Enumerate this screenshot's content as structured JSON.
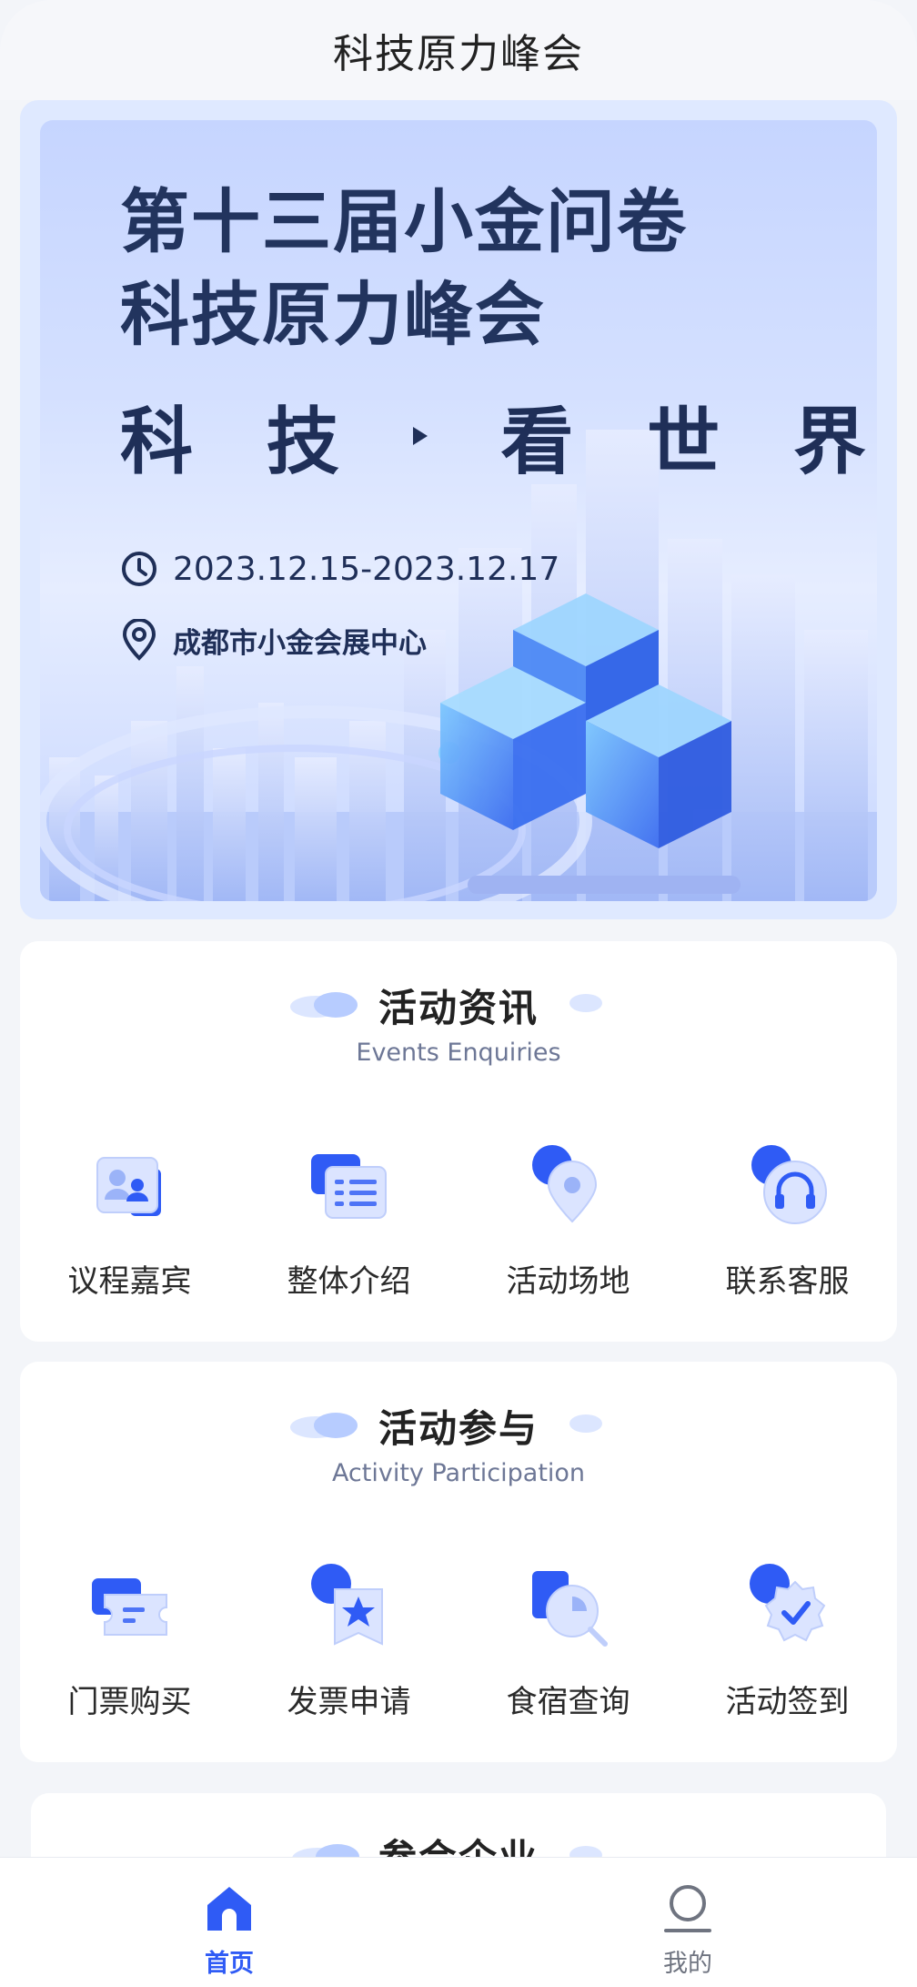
{
  "app": {
    "title": "科技原力峰会"
  },
  "banner": {
    "title_line1": "第十三届小金问卷",
    "title_line2": "科技原力峰会",
    "slogan_left": [
      "科",
      "技"
    ],
    "slogan_right": [
      "看",
      "世",
      "界"
    ],
    "date": "2023.12.15-2023.12.17",
    "venue": "成都市小金会展中心"
  },
  "events": {
    "title": "活动资讯",
    "subtitle": "Events Enquiries",
    "items": [
      {
        "label": "议程嘉宾",
        "icon": "guest-icon"
      },
      {
        "label": "整体介绍",
        "icon": "intro-icon"
      },
      {
        "label": "活动场地",
        "icon": "location-icon"
      },
      {
        "label": "联系客服",
        "icon": "headset-icon"
      }
    ]
  },
  "participation": {
    "title": "活动参与",
    "subtitle": "Activity Participation",
    "items": [
      {
        "label": "门票购买",
        "icon": "ticket-icon"
      },
      {
        "label": "发票申请",
        "icon": "invoice-icon"
      },
      {
        "label": "食宿查询",
        "icon": "search-icon"
      },
      {
        "label": "活动签到",
        "icon": "check-badge-icon"
      }
    ]
  },
  "companies": {
    "title": "参会企业"
  },
  "nav": {
    "home": "首页",
    "me": "我的"
  },
  "colors": {
    "accent": "#2f5bf5",
    "banner_text": "#22345e"
  }
}
